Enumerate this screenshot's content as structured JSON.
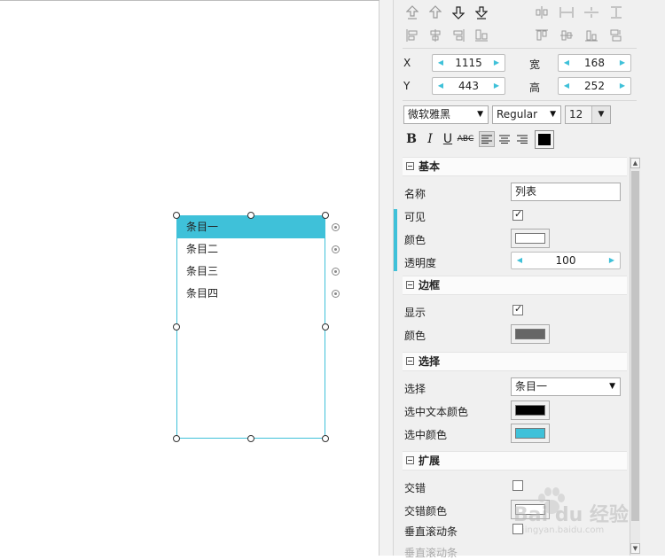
{
  "canvas": {
    "list_items": [
      "条目一",
      "条目二",
      "条目三",
      "条目四"
    ],
    "selected_index": 0
  },
  "geometry": {
    "x_label": "X",
    "x_value": "1115",
    "y_label": "Y",
    "y_value": "443",
    "w_label": "宽",
    "w_value": "168",
    "h_label": "高",
    "h_value": "252"
  },
  "font": {
    "family": "微软雅黑",
    "weight": "Regular",
    "size": "12"
  },
  "format_buttons": [
    "B",
    "I",
    "U",
    "ABC"
  ],
  "sections": {
    "basic": {
      "title": "基本",
      "name_label": "名称",
      "name_value": "列表",
      "visible_label": "可见",
      "visible_checked": true,
      "color_label": "颜色",
      "color_value": "#ffffff",
      "opacity_label": "透明度",
      "opacity_value": "100"
    },
    "border": {
      "title": "边框",
      "show_label": "显示",
      "show_checked": true,
      "color_label": "颜色",
      "color_value": "#666666"
    },
    "selection": {
      "title": "选择",
      "select_label": "选择",
      "select_value": "条目一",
      "text_color_label": "选中文本颜色",
      "text_color_value": "#000000",
      "bg_color_label": "选中颜色",
      "bg_color_value": "#3fc1d9"
    },
    "extend": {
      "title": "扩展",
      "alternate_label": "交错",
      "alternate_checked": false,
      "alt_color_label": "交错颜色",
      "vscroll_label": "垂直滚动条",
      "vscroll_checked": false,
      "cut_label": "垂直滚动条"
    }
  },
  "watermark": {
    "brand": "Bai du 经验",
    "url": "jingyan.baidu.com"
  },
  "colors": {
    "accent": "#3fc1d9",
    "panel_bg": "#f0f0f0"
  }
}
